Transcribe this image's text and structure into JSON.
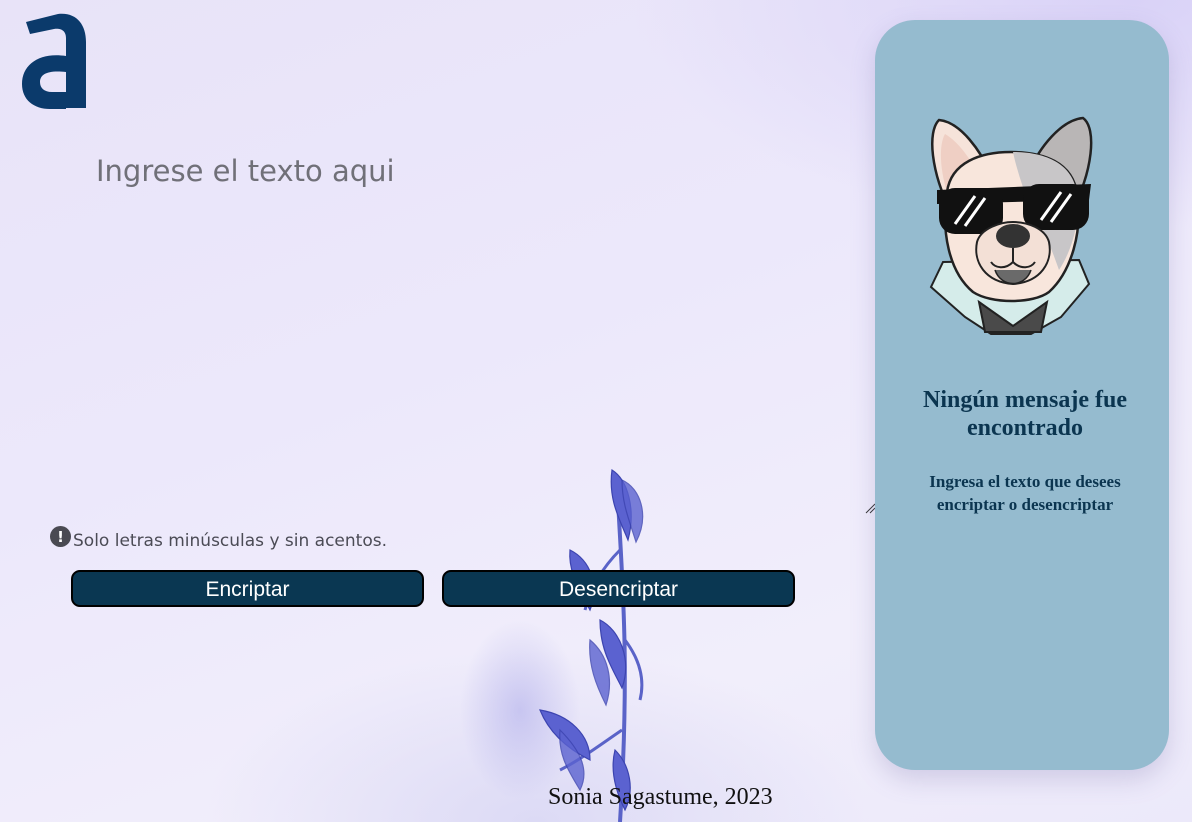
{
  "header": {
    "logo_icon": "alura-a-logo-icon",
    "logo_color": "#0b3a6b"
  },
  "input": {
    "placeholder": "Ingrese el texto aqui",
    "value": ""
  },
  "hint": {
    "icon": "exclamation-circle-icon",
    "text": "Solo letras minúsculas y sin acentos."
  },
  "buttons": {
    "encrypt_label": "Encriptar",
    "decrypt_label": "Desencriptar",
    "color": "#0a3752"
  },
  "output": {
    "illustration": "dog-with-sunglasses-icon",
    "title": "Ningún mensaje fue encontrado",
    "subtitle": "Ingresa el texto que desees encriptar o desencriptar",
    "background": "#95bbcf"
  },
  "footer": {
    "text": "Sonia Sagastume, 2023"
  }
}
